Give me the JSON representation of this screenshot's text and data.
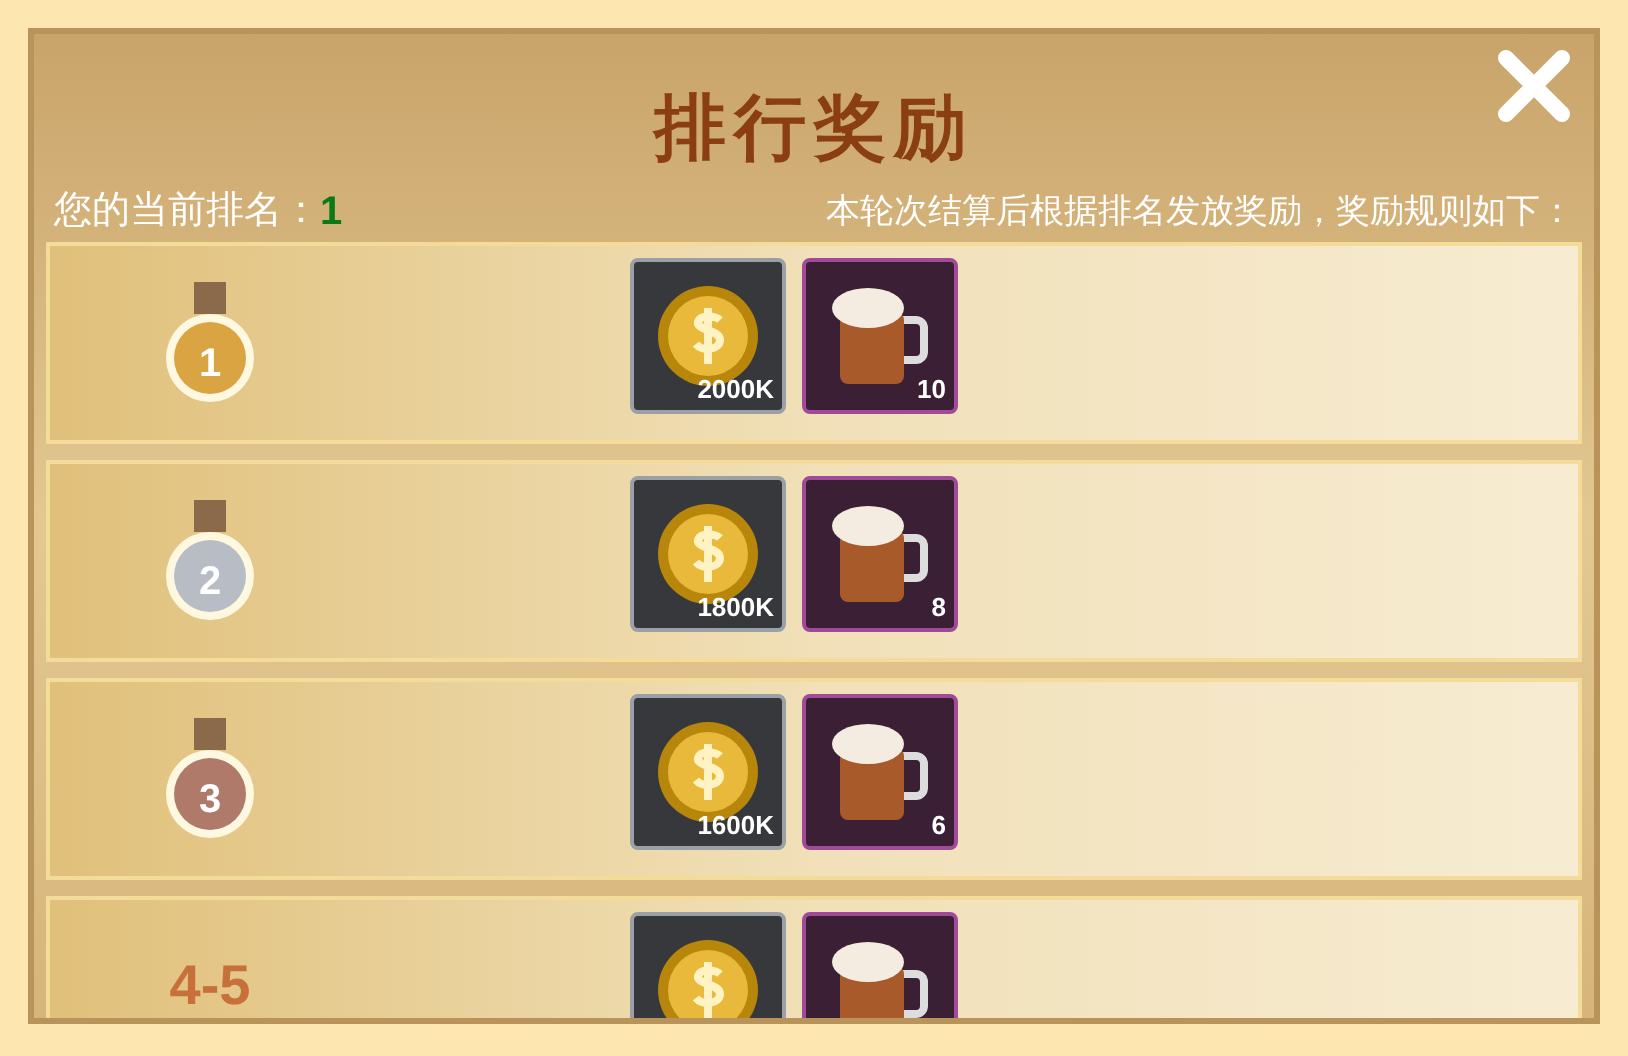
{
  "title": "排行奖励",
  "my_rank": {
    "label": "您的当前排名：",
    "value": "1"
  },
  "rule_text": "本轮次结算后根据排名发放奖励，奖励规则如下：",
  "rows": [
    {
      "rank": "1",
      "kind": "medal",
      "color": "#d9a441",
      "rewards": [
        {
          "kind": "coin",
          "amount": "2000K"
        },
        {
          "kind": "beer",
          "amount": "10"
        }
      ]
    },
    {
      "rank": "2",
      "kind": "medal",
      "color": "#b8bcc4",
      "rewards": [
        {
          "kind": "coin",
          "amount": "1800K"
        },
        {
          "kind": "beer",
          "amount": "8"
        }
      ]
    },
    {
      "rank": "3",
      "kind": "medal",
      "color": "#b07a6a",
      "rewards": [
        {
          "kind": "coin",
          "amount": "1600K"
        },
        {
          "kind": "beer",
          "amount": "6"
        }
      ]
    },
    {
      "rank": "4-5",
      "kind": "text",
      "rewards": [
        {
          "kind": "coin"
        },
        {
          "kind": "beer"
        }
      ]
    }
  ]
}
